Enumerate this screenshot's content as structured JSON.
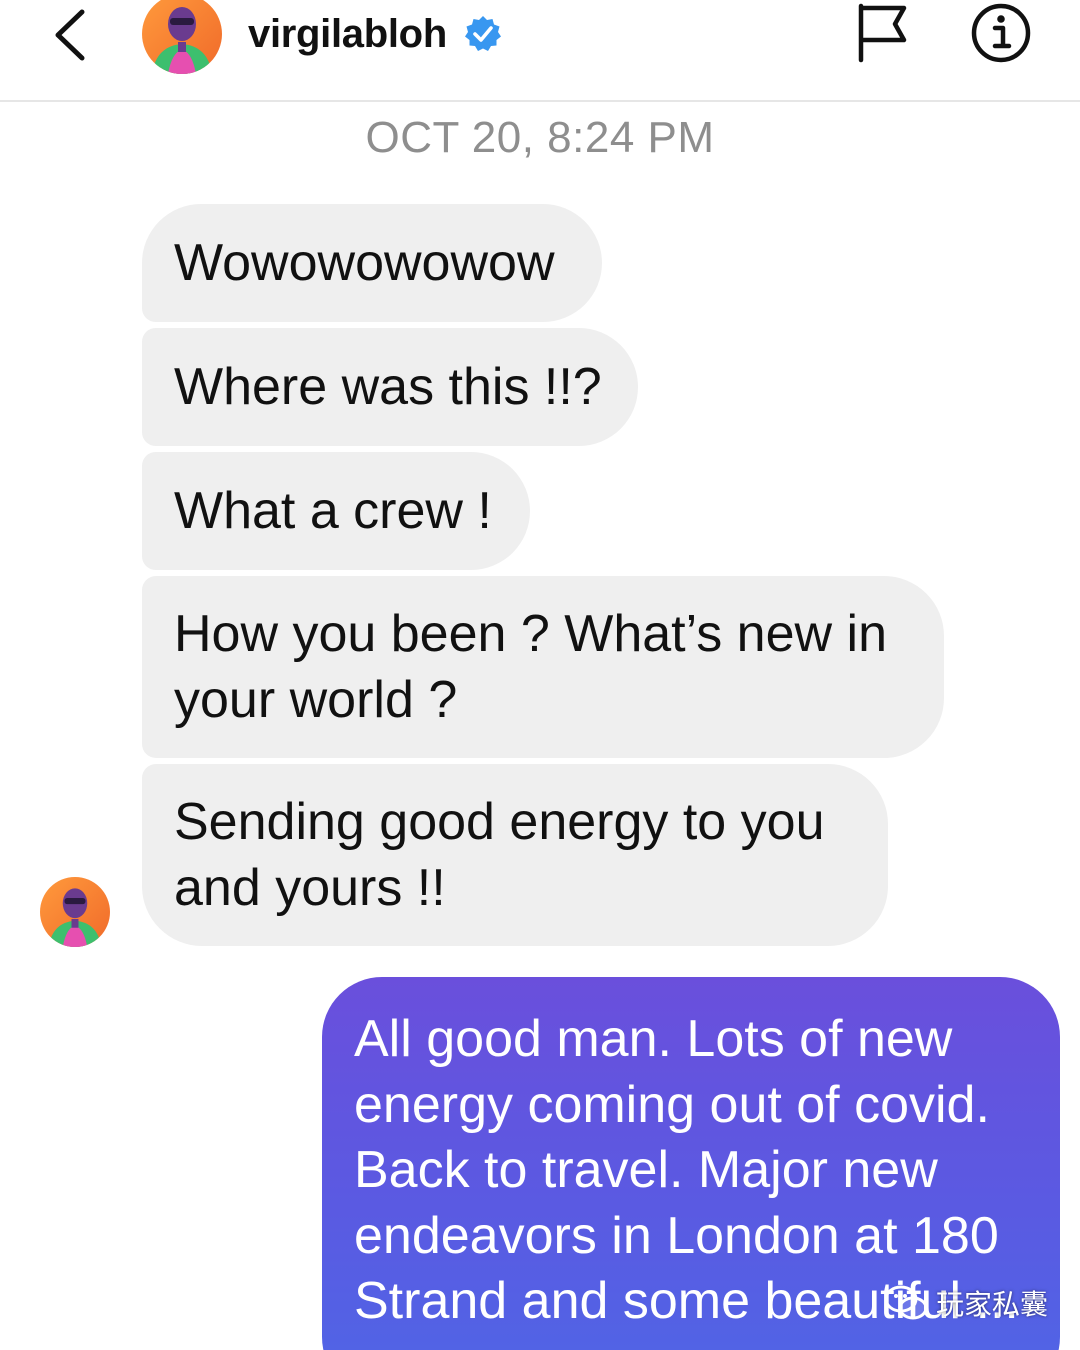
{
  "header": {
    "username": "virgilabloh",
    "back_icon": "chevron-left-icon",
    "flag_icon": "flag-icon",
    "info_icon": "info-icon",
    "verified_icon": "verified-badge-icon",
    "verified_color": "#3897f0"
  },
  "thread": {
    "timestamp": "OCT 20, 8:24 PM",
    "incoming_bubble_color": "#efefef",
    "messages_in": [
      {
        "text": "Wowowowowow"
      },
      {
        "text": "Where was this !!?"
      },
      {
        "text": "What a crew !"
      },
      {
        "text": "How you been ? What’s new in your world ?"
      },
      {
        "text": "Sending good energy to you and yours !!"
      }
    ],
    "messages_out": [
      {
        "text": "All good man. Lots of new energy coming out of covid. Back to travel. Major new endeavors in London at 180 Strand and some beautiful ..."
      }
    ],
    "outgoing_gradient": [
      "#6a4fdc",
      "#4f66e6"
    ]
  },
  "watermark": {
    "text": "玩家私囊",
    "icon": "wechat-icon"
  }
}
